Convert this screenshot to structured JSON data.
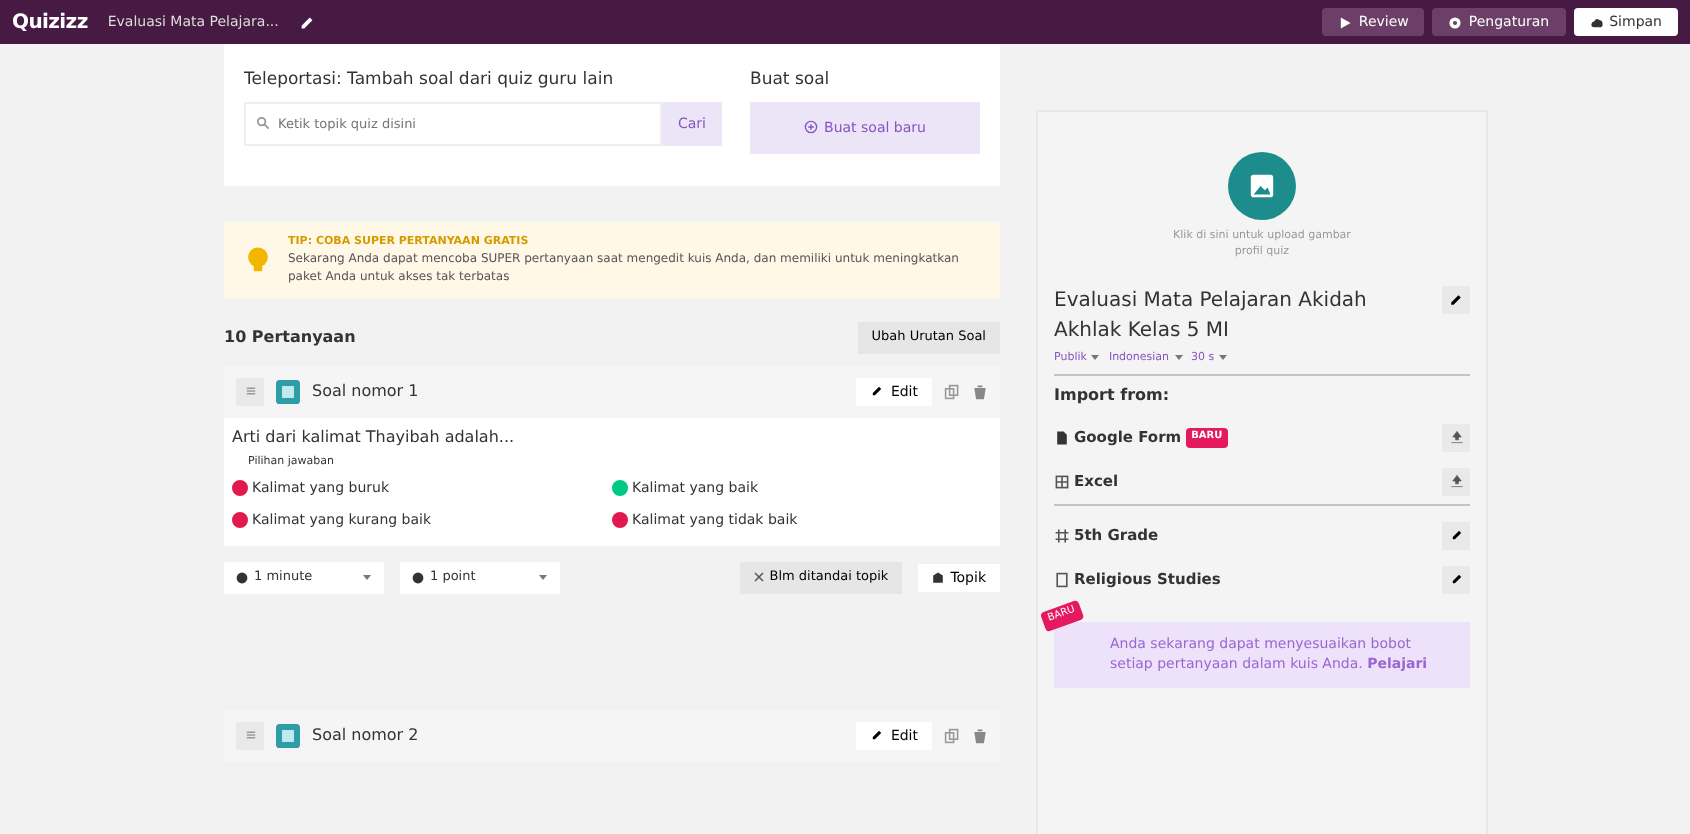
{
  "navbar": {
    "logo": "Quizizz",
    "quiz_title": "Evaluasi Mata Pelajara...",
    "buttons": [
      {
        "kind": "review",
        "label": "Review"
      },
      {
        "kind": "settings",
        "label": "Pengaturan"
      },
      {
        "kind": "save",
        "label": "Simpan"
      }
    ]
  },
  "teleport": {
    "title": "Teleportasi: Tambah soal dari quiz guru lain",
    "placeholder": "Ketik topik quiz disini",
    "search_button": "Cari"
  },
  "create": {
    "title": "Buat soal",
    "button": "Buat soal baru"
  },
  "tip": {
    "heading": "TIP: COBA SUPER PERTANYAAN GRATIS",
    "text": "Sekarang Anda dapat mencoba SUPER pertanyaan saat mengedit kuis Anda, dan memiliki untuk meningkatkan paket Anda untuk akses tak terbatas"
  },
  "questions_header": {
    "count": "10 Pertanyaan",
    "reorder_button": "Ubah Urutan Soal"
  },
  "questions": [
    {
      "title": "Soal nomor 1",
      "edit": "Edit",
      "text": "Arti dari kalimat Thayibah adalah...",
      "options_label": "Pilihan jawaban",
      "options": [
        {
          "text": "Kalimat yang buruk",
          "correct": false
        },
        {
          "text": "Kalimat yang baik",
          "correct": true
        },
        {
          "text": "Kalimat yang kurang baik",
          "correct": false
        },
        {
          "text": "Kalimat yang tidak baik",
          "correct": false
        }
      ],
      "time": "1 minute",
      "points": "1 point",
      "topic_tag": "Blm ditandai topik",
      "topic_button": "Topik"
    },
    {
      "title": "Soal nomor 2",
      "edit": "Edit"
    }
  ],
  "sidebar": {
    "upload_hint": "Klik di sini untuk upload gambar profil quiz",
    "quiz_name": "Evaluasi Mata Pelajaran Akidah Akhlak Kelas 5 MI",
    "visibility": "Publik",
    "language": "Indonesian",
    "duration": "30 s",
    "import_label": "Import from:",
    "imports": [
      {
        "kind": "doc",
        "label": "Google Form",
        "badge": "BARU"
      },
      {
        "kind": "sheet",
        "label": "Excel"
      }
    ],
    "tags": [
      {
        "kind": "grade",
        "label": "5th Grade"
      },
      {
        "kind": "subject",
        "label": "Religious Studies"
      }
    ],
    "promo": {
      "badge": "BARU",
      "text": "Anda sekarang dapat menyesuaikan bobot setiap pertanyaan dalam kuis Anda. **Pelajari**"
    }
  }
}
